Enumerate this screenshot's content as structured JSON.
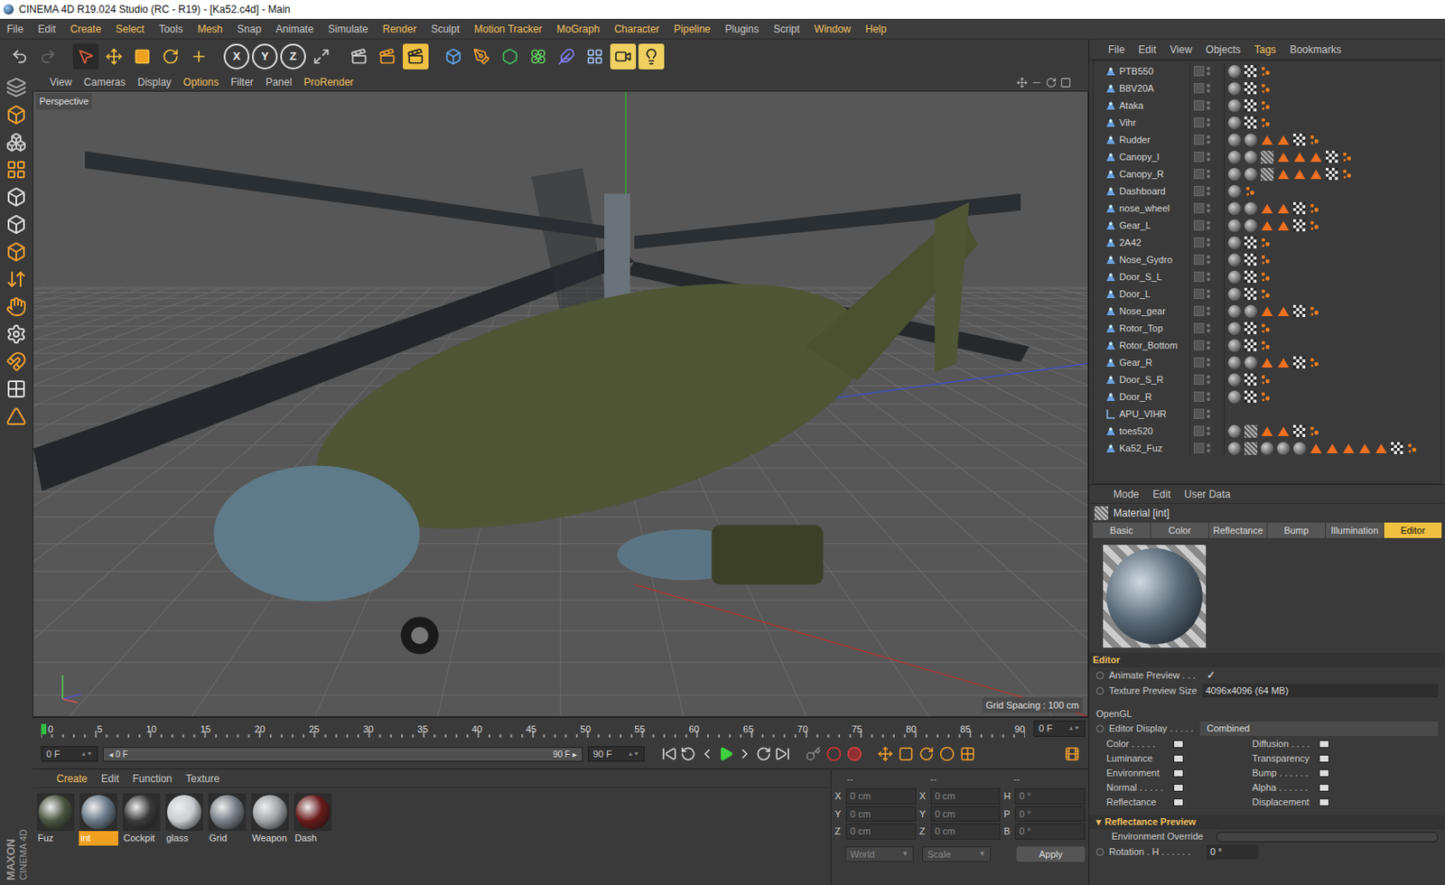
{
  "window": {
    "title": "CINEMA 4D R19.024 Studio (RC - R19) - [Ka52.c4d] - Main"
  },
  "menu": [
    {
      "label": "File",
      "highlighted": false
    },
    {
      "label": "Edit",
      "highlighted": false
    },
    {
      "label": "Create",
      "highlighted": true
    },
    {
      "label": "Select",
      "highlighted": true
    },
    {
      "label": "Tools",
      "highlighted": false
    },
    {
      "label": "Mesh",
      "highlighted": true
    },
    {
      "label": "Snap",
      "highlighted": false
    },
    {
      "label": "Animate",
      "highlighted": false
    },
    {
      "label": "Simulate",
      "highlighted": false
    },
    {
      "label": "Render",
      "highlighted": true
    },
    {
      "label": "Sculpt",
      "highlighted": false
    },
    {
      "label": "Motion Tracker",
      "highlighted": true
    },
    {
      "label": "MoGraph",
      "highlighted": true
    },
    {
      "label": "Character",
      "highlighted": true
    },
    {
      "label": "Pipeline",
      "highlighted": true
    },
    {
      "label": "Plugins",
      "highlighted": false
    },
    {
      "label": "Script",
      "highlighted": false
    },
    {
      "label": "Window",
      "highlighted": true
    },
    {
      "label": "Help",
      "highlighted": true
    }
  ],
  "toolbar": {
    "axes": [
      "X",
      "Y",
      "Z"
    ]
  },
  "side_brand": {
    "maker": "MAXON",
    "product": "CINEMA 4D"
  },
  "viewport": {
    "menu": [
      {
        "label": "View",
        "highlighted": false
      },
      {
        "label": "Cameras",
        "highlighted": false
      },
      {
        "label": "Display",
        "highlighted": false
      },
      {
        "label": "Options",
        "highlighted": true
      },
      {
        "label": "Filter",
        "highlighted": false
      },
      {
        "label": "Panel",
        "highlighted": false
      },
      {
        "label": "ProRender",
        "highlighted": true
      }
    ],
    "label": "Perspective",
    "grid_spacing": "Grid Spacing : 100 cm"
  },
  "timeline": {
    "ticks": [
      "0",
      "5",
      "10",
      "15",
      "20",
      "25",
      "30",
      "35",
      "40",
      "45",
      "50",
      "55",
      "60",
      "65",
      "70",
      "75",
      "80",
      "85",
      "90"
    ],
    "current": "0 F",
    "start": "0 F",
    "range_start": "0 F",
    "range_end": "90 F",
    "end": "90 F"
  },
  "materials": {
    "menu": [
      {
        "label": "Create",
        "highlighted": true
      },
      {
        "label": "Edit",
        "highlighted": false
      },
      {
        "label": "Function",
        "highlighted": false
      },
      {
        "label": "Texture",
        "highlighted": false
      }
    ],
    "items": [
      {
        "name": "Fuz",
        "selected": false,
        "color": "#4a5540"
      },
      {
        "name": "int",
        "selected": true,
        "color": "#6a7a88"
      },
      {
        "name": "Cockpit",
        "selected": false,
        "color": "#3a3a3a"
      },
      {
        "name": "glass",
        "selected": false,
        "color": "#c8ccd0"
      },
      {
        "name": "Grid",
        "selected": false,
        "color": "#7a8088"
      },
      {
        "name": "Weapon",
        "selected": false,
        "color": "#a0a4a8"
      },
      {
        "name": "Dash",
        "selected": false,
        "color": "#6a1a1a"
      }
    ]
  },
  "coordinates": {
    "columns": [
      {
        "header": "--",
        "rows": [
          {
            "axis": "X",
            "value": "0 cm"
          },
          {
            "axis": "Y",
            "value": "0 cm"
          },
          {
            "axis": "Z",
            "value": "0 cm"
          }
        ]
      },
      {
        "header": "--",
        "rows": [
          {
            "axis": "X",
            "value": "0 cm"
          },
          {
            "axis": "Y",
            "value": "0 cm"
          },
          {
            "axis": "Z",
            "value": "0 cm"
          }
        ]
      },
      {
        "header": "--",
        "rows": [
          {
            "axis": "H",
            "value": "0 °"
          },
          {
            "axis": "P",
            "value": "0 °"
          },
          {
            "axis": "B",
            "value": "0 °"
          }
        ]
      }
    ],
    "dropdowns": [
      "World",
      "Scale"
    ],
    "button": "Apply"
  },
  "object_manager": {
    "menu": [
      {
        "label": "File",
        "highlighted": false
      },
      {
        "label": "Edit",
        "highlighted": false
      },
      {
        "label": "View",
        "highlighted": false
      },
      {
        "label": "Objects",
        "highlighted": false
      },
      {
        "label": "Tags",
        "highlighted": true
      },
      {
        "label": "Bookmarks",
        "highlighted": false
      }
    ],
    "objects": [
      {
        "name": "PTB550",
        "kind": "polygon",
        "tags": [
          "sphere",
          "checker",
          "phong"
        ]
      },
      {
        "name": "B8V20A",
        "kind": "polygon",
        "tags": [
          "sphere",
          "checker",
          "phong"
        ]
      },
      {
        "name": "Ataka",
        "kind": "polygon",
        "tags": [
          "sphere",
          "checker",
          "phong"
        ]
      },
      {
        "name": "Vihr",
        "kind": "polygon",
        "tags": [
          "sphere",
          "checker",
          "phong"
        ]
      },
      {
        "name": "Rudder",
        "kind": "polygon",
        "tags": [
          "sphere",
          "sphere",
          "uvw",
          "uvw",
          "checker",
          "phong"
        ]
      },
      {
        "name": "Canopy_l",
        "kind": "polygon",
        "tags": [
          "sphere",
          "sphere",
          "texture",
          "uvw",
          "uvw",
          "uvw",
          "checker",
          "phong"
        ]
      },
      {
        "name": "Canopy_R",
        "kind": "polygon",
        "tags": [
          "sphere",
          "sphere",
          "texture",
          "uvw",
          "uvw",
          "uvw",
          "checker",
          "phong"
        ]
      },
      {
        "name": "Dashboard",
        "kind": "polygon",
        "tags": [
          "sphere",
          "phong"
        ]
      },
      {
        "name": "nose_wheel",
        "kind": "polygon",
        "tags": [
          "sphere",
          "sphere",
          "uvw",
          "uvw",
          "checker",
          "phong"
        ]
      },
      {
        "name": "Gear_L",
        "kind": "polygon",
        "tags": [
          "sphere",
          "sphere",
          "uvw",
          "uvw",
          "checker",
          "phong"
        ]
      },
      {
        "name": "2A42",
        "kind": "polygon",
        "tags": [
          "sphere",
          "checker",
          "phong"
        ]
      },
      {
        "name": "Nose_Gydro",
        "kind": "polygon",
        "tags": [
          "sphere",
          "checker",
          "phong"
        ]
      },
      {
        "name": "Door_S_L",
        "kind": "polygon",
        "tags": [
          "sphere",
          "checker",
          "phong"
        ]
      },
      {
        "name": "Door_L",
        "kind": "polygon",
        "tags": [
          "sphere",
          "checker",
          "phong"
        ]
      },
      {
        "name": "Nose_gear",
        "kind": "polygon",
        "tags": [
          "sphere",
          "sphere",
          "uvw",
          "uvw",
          "checker",
          "phong"
        ]
      },
      {
        "name": "Rotor_Top",
        "kind": "polygon",
        "tags": [
          "sphere",
          "checker",
          "phong"
        ]
      },
      {
        "name": "Rotor_Bottom",
        "kind": "polygon",
        "tags": [
          "sphere",
          "checker",
          "phong"
        ]
      },
      {
        "name": "Gear_R",
        "kind": "polygon",
        "tags": [
          "sphere",
          "sphere",
          "uvw",
          "uvw",
          "checker",
          "phong"
        ]
      },
      {
        "name": "Door_S_R",
        "kind": "polygon",
        "tags": [
          "sphere",
          "checker",
          "phong"
        ]
      },
      {
        "name": "Door_R",
        "kind": "polygon",
        "tags": [
          "sphere",
          "checker",
          "phong"
        ]
      },
      {
        "name": "APU_VIHR",
        "kind": "null",
        "tags": []
      },
      {
        "name": "toes520",
        "kind": "polygon",
        "tags": [
          "sphere",
          "texture",
          "uvw",
          "uvw",
          "checker",
          "phong"
        ]
      },
      {
        "name": "Ka52_Fuz",
        "kind": "polygon",
        "tags": [
          "sphere",
          "texture",
          "sphere",
          "sphere",
          "sphere",
          "uvw",
          "uvw",
          "uvw",
          "uvw",
          "uvw",
          "checker",
          "phong"
        ]
      }
    ]
  },
  "attribute_manager": {
    "menu": [
      "Mode",
      "Edit",
      "User Data"
    ],
    "title": "Material [int]",
    "tabs": [
      {
        "label": "Basic",
        "selected": false
      },
      {
        "label": "Color",
        "selected": false
      },
      {
        "label": "Reflectance",
        "selected": false
      },
      {
        "label": "Bump",
        "selected": false
      },
      {
        "label": "Illumination",
        "selected": false
      },
      {
        "label": "Editor",
        "selected": true
      }
    ],
    "section": "Editor",
    "animate_preview": {
      "label": "Animate Preview . . .",
      "checked": true,
      "mark": "✓"
    },
    "texture_preview_size": {
      "label": "Texture Preview Size",
      "value": "4096x4096 (64 MB)"
    },
    "opengl": "OpenGL",
    "editor_display": {
      "label": "Editor Display . . . . .",
      "value": "Combined"
    },
    "channels": [
      [
        "Color . . . . .",
        "Diffusion . . . ."
      ],
      [
        "Luminance",
        "Transparency"
      ],
      [
        "Environment",
        "Bump . . . . . ."
      ],
      [
        "Normal . . . . .",
        "Alpha . . . . . ."
      ],
      [
        "Reflectance",
        "Displacement"
      ]
    ],
    "reflectance_preview": {
      "label": "Reflectance Preview",
      "expanded": true,
      "mark": "▾"
    },
    "environment_override": "Environment Override",
    "rotation": {
      "label": "Rotation . H . . . . . .",
      "value": "0 °"
    }
  }
}
